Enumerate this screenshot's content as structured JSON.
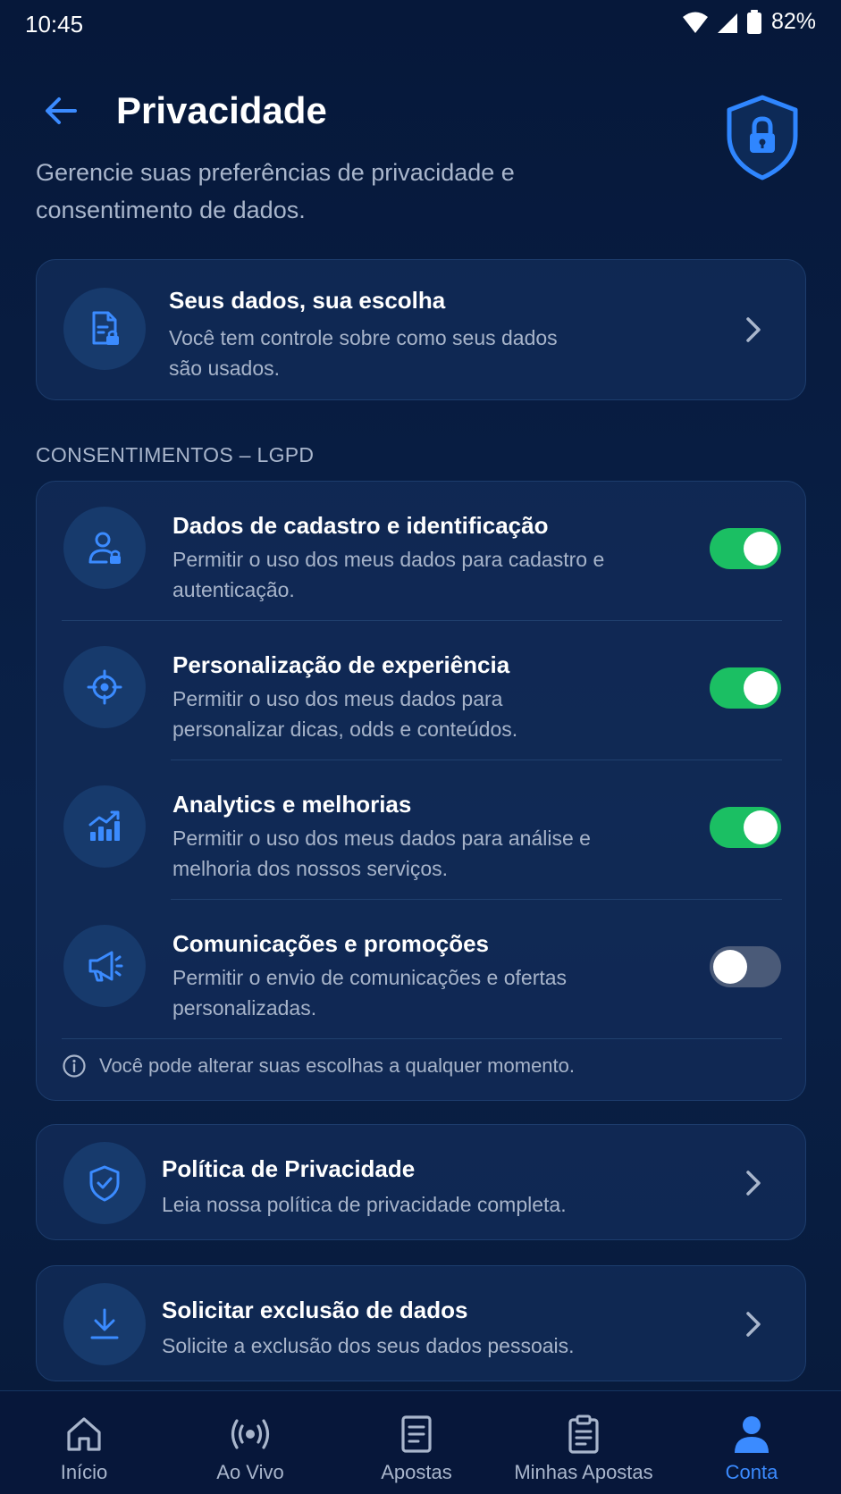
{
  "status_bar": {
    "time": "10:45",
    "battery": "82%"
  },
  "header": {
    "title": "Privacidade",
    "subtitle": "Gerencie suas preferências de privacidade e consentimento de dados."
  },
  "summary_card": {
    "title": "Seus dados, sua escolha",
    "description": "Você tem controle sobre como seus dados são usados."
  },
  "consents": {
    "section_label": "CONSENTIMENTOS – LGPD",
    "items": [
      {
        "title": "Dados de cadastro e identificação",
        "description": "Permitir o uso dos meus dados para cadastro e autenticação.",
        "enabled": true,
        "icon": "user-lock-icon"
      },
      {
        "title": "Personalização de experiência",
        "description": "Permitir o uso dos meus dados para personalizar dicas, odds e conteúdos.",
        "enabled": true,
        "icon": "target-icon"
      },
      {
        "title": "Analytics e melhorias",
        "description": "Permitir o uso dos meus dados para análise e melhoria dos nossos serviços.",
        "enabled": true,
        "icon": "chart-icon"
      },
      {
        "title": "Comunicações e promoções",
        "description": "Permitir o envio de comunicações e ofertas personalizadas.",
        "enabled": false,
        "icon": "megaphone-icon"
      }
    ],
    "info_note": "Você pode alterar suas escolhas a qualquer momento."
  },
  "policy_card": {
    "title": "Política de Privacidade",
    "description": "Leia nossa política de privacidade completa."
  },
  "deletion_card": {
    "title": "Solicitar exclusão de dados",
    "description": "Solicite a exclusão dos seus dados pessoais."
  },
  "bottom_nav": {
    "items": [
      {
        "label": "Início",
        "icon": "home-icon",
        "active": false
      },
      {
        "label": "Ao Vivo",
        "icon": "live-icon",
        "active": false
      },
      {
        "label": "Apostas",
        "icon": "document-icon",
        "active": false
      },
      {
        "label": "Minhas Apostas",
        "icon": "clipboard-icon",
        "active": false
      },
      {
        "label": "Conta",
        "icon": "account-icon",
        "active": true
      }
    ]
  },
  "colors": {
    "accent": "#3b8bff",
    "toggle_on": "#1bbf63",
    "toggle_off": "#4a5a78",
    "background": "#071a3a",
    "card": "#122c58"
  }
}
